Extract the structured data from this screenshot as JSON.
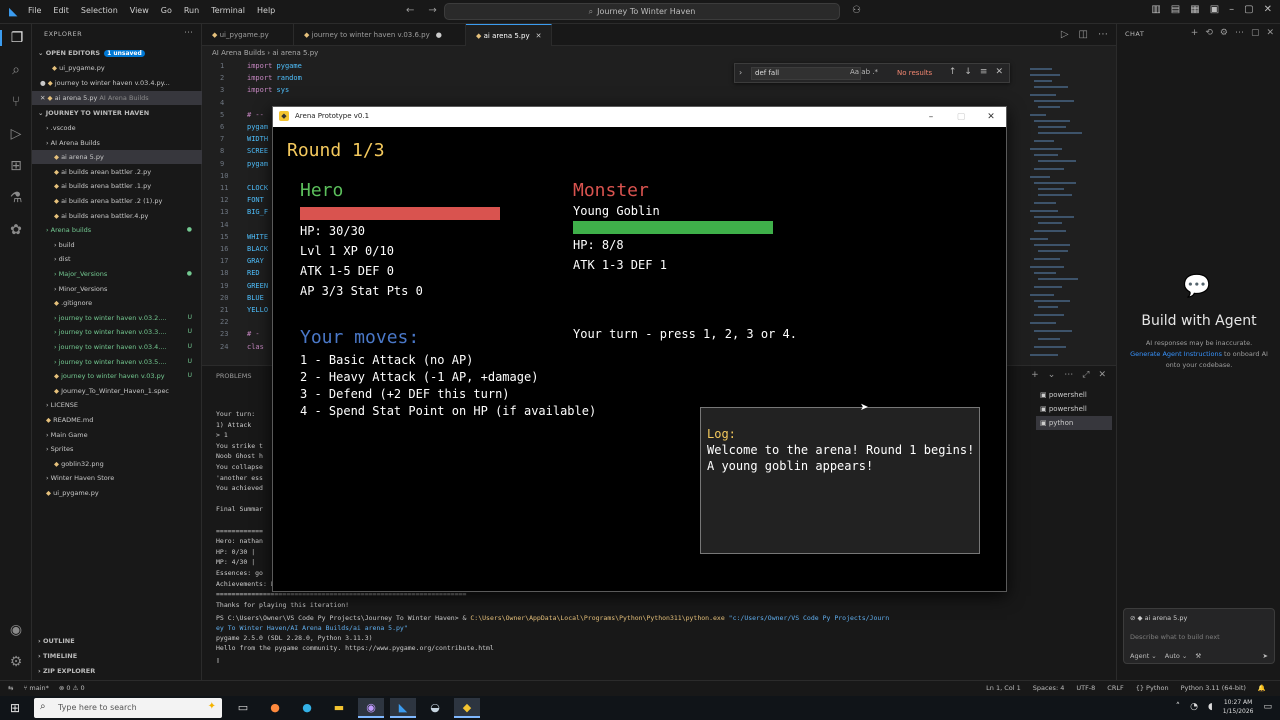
{
  "titlebar": {
    "menu": [
      "File",
      "Edit",
      "Selection",
      "View",
      "Go",
      "Run",
      "Terminal",
      "Help"
    ],
    "search": "Journey To Winter Haven"
  },
  "explorer": {
    "title": "EXPLORER",
    "open_editors": "OPEN EDITORS",
    "unsaved_badge": "1 unsaved",
    "open_files": [
      {
        "name": "ui_pygame.py",
        "extra": ""
      },
      {
        "name": "journey to winter haven v.03.4.py...",
        "extra": ""
      },
      {
        "name": "ai arena 5.py",
        "extra": "AI Arena Builds"
      }
    ],
    "workspace": "JOURNEY TO WINTER HAVEN",
    "tree": [
      {
        "name": ".vscode",
        "indent": 1,
        "mark": "",
        "green": false,
        "sel": false
      },
      {
        "name": "AI Arena Builds",
        "indent": 1,
        "mark": "",
        "green": false,
        "sel": false
      },
      {
        "name": "ai arena 5.py",
        "indent": 2,
        "mark": "",
        "green": false,
        "sel": true
      },
      {
        "name": "ai builds arean battler .2.py",
        "indent": 2,
        "mark": "",
        "green": false,
        "sel": false
      },
      {
        "name": "ai builds arena battler .1.py",
        "indent": 2,
        "mark": "",
        "green": false,
        "sel": false
      },
      {
        "name": "ai builds arena battler .2 (1).py",
        "indent": 2,
        "mark": "",
        "green": false,
        "sel": false
      },
      {
        "name": "ai builds arena battler.4.py",
        "indent": 2,
        "mark": "",
        "green": false,
        "sel": false
      },
      {
        "name": "Arena builds",
        "indent": 1,
        "mark": "●",
        "green": true,
        "sel": false
      },
      {
        "name": "build",
        "indent": 2,
        "mark": "",
        "green": false,
        "sel": false
      },
      {
        "name": "dist",
        "indent": 2,
        "mark": "",
        "green": false,
        "sel": false
      },
      {
        "name": "Major_Versions",
        "indent": 2,
        "mark": "●",
        "green": true,
        "sel": false
      },
      {
        "name": "Minor_Versions",
        "indent": 2,
        "mark": "",
        "green": false,
        "sel": false
      },
      {
        "name": ".gitignore",
        "indent": 2,
        "mark": "",
        "green": false,
        "sel": false
      },
      {
        "name": "journey to winter haven v.03.2....",
        "indent": 2,
        "mark": "U",
        "green": true,
        "sel": false
      },
      {
        "name": "journey to winter haven v.03.3....",
        "indent": 2,
        "mark": "U",
        "green": true,
        "sel": false
      },
      {
        "name": "journey to winter haven v.03.4....",
        "indent": 2,
        "mark": "U",
        "green": true,
        "sel": false
      },
      {
        "name": "journey to winter haven v.03.5....",
        "indent": 2,
        "mark": "U",
        "green": true,
        "sel": false
      },
      {
        "name": "journey to winter haven v.03.py",
        "indent": 2,
        "mark": "U",
        "green": true,
        "sel": false
      },
      {
        "name": "Journey_To_Winter_Haven_1.spec",
        "indent": 2,
        "mark": "",
        "green": false,
        "sel": false
      },
      {
        "name": "LICENSE",
        "indent": 1,
        "mark": "",
        "green": false,
        "sel": false
      },
      {
        "name": "README.md",
        "indent": 1,
        "mark": "",
        "green": false,
        "sel": false
      },
      {
        "name": "Main Game",
        "indent": 1,
        "mark": "",
        "green": false,
        "sel": false
      },
      {
        "name": "Sprites",
        "indent": 1,
        "mark": "",
        "green": false,
        "sel": false
      },
      {
        "name": "goblin32.png",
        "indent": 2,
        "mark": "",
        "green": false,
        "sel": false
      },
      {
        "name": "Winter Haven Store",
        "indent": 1,
        "mark": "",
        "green": false,
        "sel": false
      },
      {
        "name": "ui_pygame.py",
        "indent": 1,
        "mark": "",
        "green": false,
        "sel": false
      }
    ],
    "outline": "OUTLINE",
    "timeline": "TIMELINE",
    "zip": "ZIP EXPLORER"
  },
  "tabs": [
    {
      "label": "ui_pygame.py",
      "dot": ""
    },
    {
      "label": "journey to winter haven v.03.6.py",
      "dot": "●"
    },
    {
      "label": "ai arena 5.py",
      "dot": "✕"
    }
  ],
  "breadcrumb": "AI Arena Builds  ›  ai arena 5.py",
  "code": [
    {
      "n": "1",
      "kw": "import",
      "id": "pygame"
    },
    {
      "n": "2",
      "kw": "import",
      "id": "random"
    },
    {
      "n": "3",
      "kw": "import",
      "id": "sys"
    },
    {
      "n": "4",
      "kw": "",
      "id": ""
    },
    {
      "n": "5",
      "kw": "# --",
      "id": ""
    },
    {
      "n": "6",
      "kw": "",
      "id": "pygam"
    },
    {
      "n": "7",
      "kw": "",
      "id": "WIDTH"
    },
    {
      "n": "8",
      "kw": "",
      "id": "SCREE"
    },
    {
      "n": "9",
      "kw": "",
      "id": "pygam"
    },
    {
      "n": "10",
      "kw": "",
      "id": ""
    },
    {
      "n": "11",
      "kw": "",
      "id": "CLOCK"
    },
    {
      "n": "12",
      "kw": "",
      "id": "FONT"
    },
    {
      "n": "13",
      "kw": "",
      "id": "BIG_F"
    },
    {
      "n": "14",
      "kw": "",
      "id": ""
    },
    {
      "n": "15",
      "kw": "",
      "id": "WHITE"
    },
    {
      "n": "16",
      "kw": "",
      "id": "BLACK"
    },
    {
      "n": "17",
      "kw": "",
      "id": "GRAY"
    },
    {
      "n": "18",
      "kw": "",
      "id": "RED"
    },
    {
      "n": "19",
      "kw": "",
      "id": "GREEN"
    },
    {
      "n": "20",
      "kw": "",
      "id": "BLUE"
    },
    {
      "n": "21",
      "kw": "",
      "id": "YELLO"
    },
    {
      "n": "22",
      "kw": "",
      "id": ""
    },
    {
      "n": "23",
      "kw": "# -",
      "id": ""
    },
    {
      "n": "24",
      "kw": "clas",
      "id": ""
    }
  ],
  "find": {
    "value": "def fall",
    "options": "Aa  ab  .*",
    "result": "No results"
  },
  "panel": {
    "tabs": "PROBLEMS",
    "terminal": [
      "Your turn:",
      "1) Attack",
      "> 1",
      "You strike t",
      "Noob Ghost h",
      "You collapse",
      "'another ess",
      "You achieved",
      "",
      "Final Summar",
      "",
      "============",
      "Hero: nathan",
      "HP: 0/30  |",
      "MP: 4/30  |",
      "Essences: go",
      "Achievements: Death in the arena",
      "================================================================",
      "Thanks for playing this iteration!"
    ],
    "ps_prompt": "PS C:\\Users\\Owner\\VS Code Py Projects\\Journey To Winter Haven> & ",
    "ps_exe": "C:\\Users\\Owner\\AppData\\Local\\Programs\\Python\\Python311\\python.exe",
    "ps_arg": " \"c:/Users/Owner/VS Code Py Projects/Journ",
    "ps_arg2": "ey To Winter Haven/AI Arena Builds/ai arena 5.py\"",
    "pg1": "pygame 2.5.0 (SDL 2.28.0, Python 3.11.3)",
    "pg2": "Hello from the pygame community. https://www.pygame.org/contribute.html",
    "term_list": [
      "powershell",
      "powershell",
      "python"
    ]
  },
  "status": {
    "left": [
      "main*",
      "⊗ 0  ⚠ 0"
    ],
    "right": [
      "Ln 1, Col 1",
      "Spaces: 4",
      "UTF-8",
      "CRLF",
      "{} Python",
      "Python 3.11 (64-bit)"
    ]
  },
  "chat": {
    "title": "CHAT",
    "heading": "Build with Agent",
    "line1": "AI responses may be inaccurate.",
    "link": "Generate Agent Instructions",
    "line2": "to onboard AI onto your codebase.",
    "file": "ai arena 5.py",
    "placeholder": "Describe what to build next",
    "mode": "Agent ⌄",
    "model": "Auto ⌄"
  },
  "taskbar": {
    "search": "Type here to search",
    "time": "10:27 AM",
    "date": "1/15/2026"
  },
  "game": {
    "window_title": "Arena Prototype v0.1",
    "round": "Round 1/3",
    "hero": {
      "label": "Hero",
      "hp_fraction": 1.0,
      "hp": "HP: 30/30",
      "lvl": "Lvl 1  XP 0/10",
      "atk": "ATK 1-5  DEF 0",
      "ap": "AP 3/3  Stat Pts 0"
    },
    "monster": {
      "label": "Monster",
      "name": "Young Goblin",
      "hp_fraction": 1.0,
      "hp": "HP: 8/8",
      "atk": "ATK 1-3  DEF 1"
    },
    "prompt": "Your turn - press 1, 2, 3 or 4.",
    "moves_title": "Your moves:",
    "moves": [
      "1 - Basic Attack (no AP)",
      "2 - Heavy Attack (-1 AP, +damage)",
      "3 - Defend (+2 DEF this turn)",
      "4 - Spend Stat Point on HP (if available)"
    ],
    "log_title": "Log:",
    "log": [
      "Welcome to the arena! Round 1 begins!",
      "A young goblin appears!"
    ]
  },
  "colors": {
    "hero_label": "#5bbf5b",
    "monster_label": "#d9534f",
    "hero_hp_bar": "#d9534f",
    "monster_hp_bar": "#3fb04a",
    "round_text": "#f4c95d",
    "moves_title": "#4a78c8",
    "accent": "#3b9cf0"
  }
}
